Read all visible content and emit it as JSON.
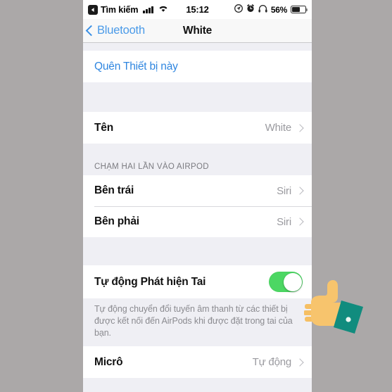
{
  "status_bar": {
    "back_chip_icon": "back-arrow-icon",
    "back_app_label": "Tìm kiếm",
    "signal_icon": "cellular-signal-icon",
    "wifi_icon": "wifi-icon",
    "time": "15:12",
    "location_icon": "location-arrow-icon",
    "alarm_icon": "alarm-clock-icon",
    "headphones_icon": "headphones-icon",
    "battery_percent": "56%",
    "battery_icon": "battery-icon"
  },
  "nav_bar": {
    "back_icon": "chevron-left-icon",
    "back_label": "Bluetooth",
    "title": "White"
  },
  "forget_group": {
    "forget_label": "Quên Thiết bị này"
  },
  "name_group": {
    "label": "Tên",
    "value": "White",
    "chevron_icon": "chevron-right-icon"
  },
  "double_tap_section": {
    "header": "CHẠM HAI LẦN VÀO AIRPOD",
    "rows": [
      {
        "label": "Bên trái",
        "value": "Siri",
        "chevron_icon": "chevron-right-icon"
      },
      {
        "label": "Bên phải",
        "value": "Siri",
        "chevron_icon": "chevron-right-icon"
      }
    ]
  },
  "ear_detection": {
    "label": "Tự động Phát hiện Tai",
    "toggle_state": "on",
    "toggle_color": "#4CD763",
    "footnote": "Tự động chuyển đổi tuyến âm thanh từ các thiết bị được kết nối đến AirPods khi được đặt trong tai của bạn."
  },
  "mic_group": {
    "label": "Micrô",
    "value": "Tự động",
    "chevron_icon": "chevron-right-icon"
  },
  "cursor": {
    "icon": "pointing-hand-cursor-icon",
    "hand_color": "#F7C26B",
    "sleeve_color": "#118C7E"
  },
  "colors": {
    "accent_blue": "#2F86E0",
    "list_background": "#EFEFF4",
    "row_background": "#FFFFFF",
    "backdrop": "#ABA8A8"
  }
}
